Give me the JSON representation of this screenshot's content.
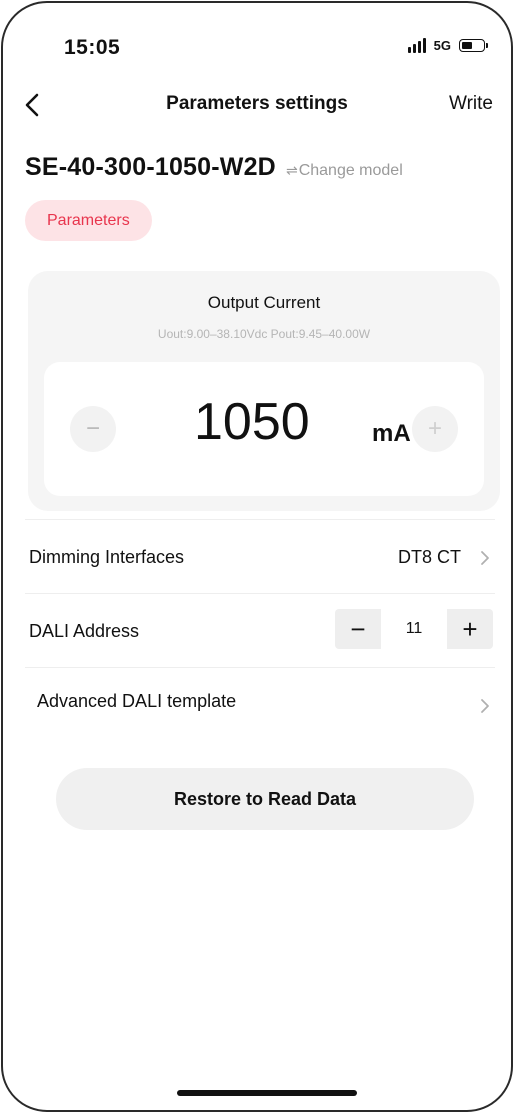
{
  "status_bar": {
    "time": "15:05",
    "network": "5G",
    "battery_level": 0.55
  },
  "nav": {
    "title": "Parameters settings",
    "write_label": "Write"
  },
  "model": {
    "name": "SE-40-300-1050-W2D",
    "change_label": "Change model",
    "change_icon": "⇌"
  },
  "tab": {
    "label": "Parameters",
    "accent_color": "#e8354d",
    "background_color": "#fde3e6"
  },
  "output_current": {
    "title": "Output Current",
    "range": "Uout:9.00–38.10Vdc   Pout:9.45–40.00W",
    "value": "1050",
    "unit": "mA",
    "minus_symbol": "−",
    "plus_symbol": "+"
  },
  "dimming": {
    "label": "Dimming Interfaces",
    "value": "DT8 CT"
  },
  "dali_address": {
    "label": "DALI Address",
    "value": "11",
    "minus_symbol": "−",
    "plus_symbol": "+"
  },
  "advanced": {
    "label": "Advanced DALI template"
  },
  "restore": {
    "label": "Restore to Read Data"
  }
}
